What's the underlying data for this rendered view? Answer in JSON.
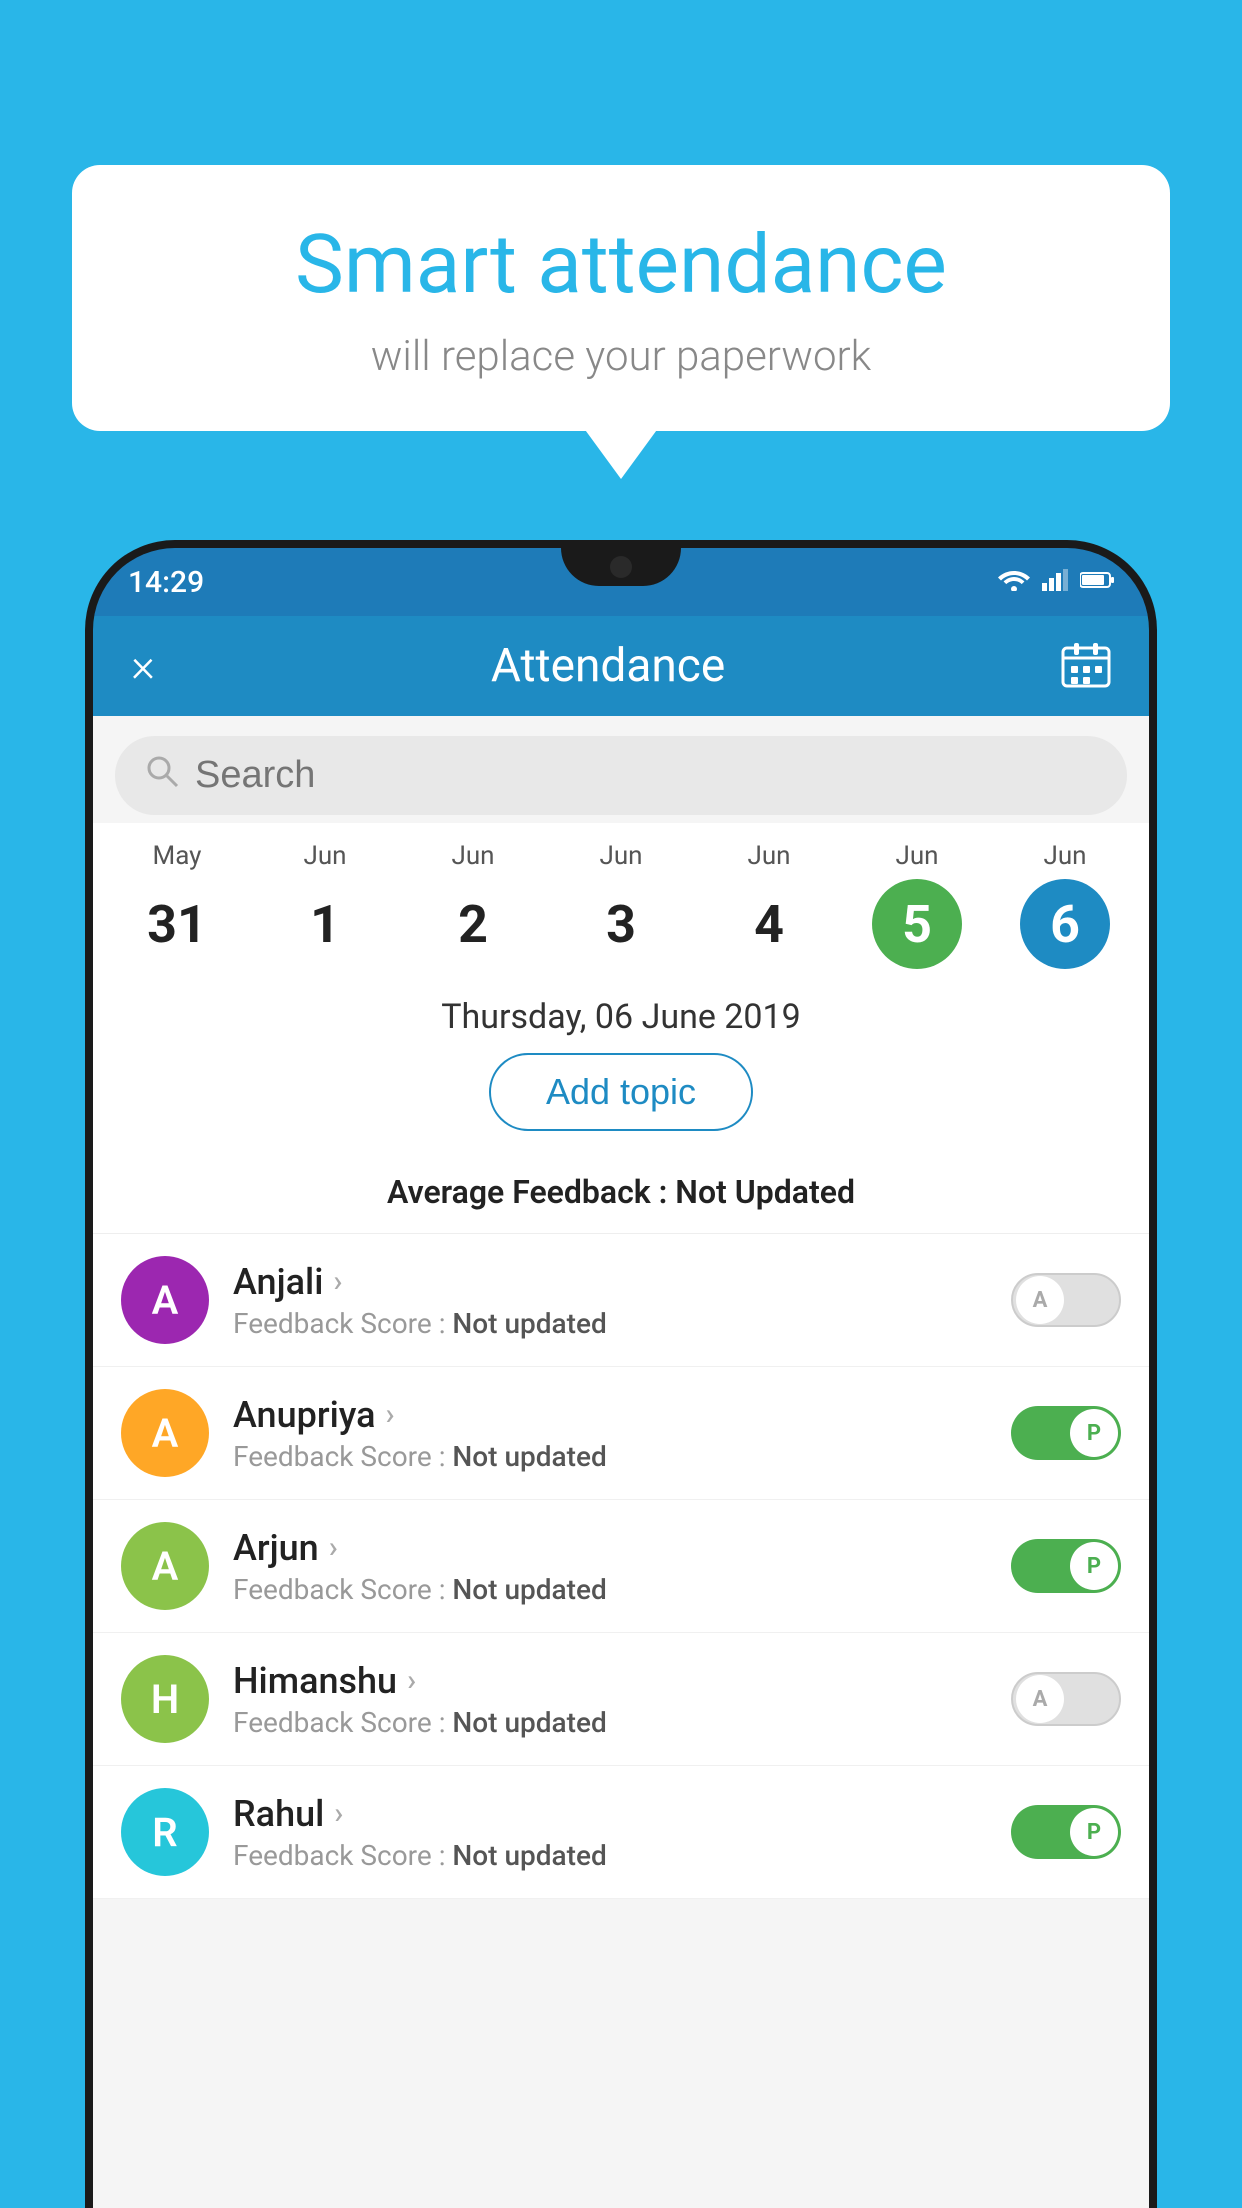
{
  "background_color": "#29b6e8",
  "bubble": {
    "title": "Smart attendance",
    "subtitle": "will replace your paperwork"
  },
  "status_bar": {
    "time": "14:29",
    "wifi_icon": "▲",
    "signal_icon": "▲",
    "battery_icon": "▮"
  },
  "header": {
    "title": "Attendance",
    "close_label": "×",
    "calendar_icon": "📅"
  },
  "search": {
    "placeholder": "Search"
  },
  "dates": [
    {
      "month": "May",
      "day": "31",
      "style": "normal"
    },
    {
      "month": "Jun",
      "day": "1",
      "style": "normal"
    },
    {
      "month": "Jun",
      "day": "2",
      "style": "normal"
    },
    {
      "month": "Jun",
      "day": "3",
      "style": "normal"
    },
    {
      "month": "Jun",
      "day": "4",
      "style": "normal"
    },
    {
      "month": "Jun",
      "day": "5",
      "style": "green"
    },
    {
      "month": "Jun",
      "day": "6",
      "style": "blue"
    }
  ],
  "selected_date": "Thursday, 06 June 2019",
  "add_topic_label": "Add topic",
  "avg_feedback_label": "Average Feedback :",
  "avg_feedback_value": "Not Updated",
  "students": [
    {
      "name": "Anjali",
      "avatar_letter": "A",
      "avatar_color": "#9c27b0",
      "feedback_label": "Feedback Score :",
      "feedback_value": "Not updated",
      "toggle_state": "off",
      "toggle_letter": "A"
    },
    {
      "name": "Anupriya",
      "avatar_letter": "A",
      "avatar_color": "#ffa726",
      "feedback_label": "Feedback Score :",
      "feedback_value": "Not updated",
      "toggle_state": "on",
      "toggle_letter": "P"
    },
    {
      "name": "Arjun",
      "avatar_letter": "A",
      "avatar_color": "#8bc34a",
      "feedback_label": "Feedback Score :",
      "feedback_value": "Not updated",
      "toggle_state": "on",
      "toggle_letter": "P"
    },
    {
      "name": "Himanshu",
      "avatar_letter": "H",
      "avatar_color": "#8bc34a",
      "feedback_label": "Feedback Score :",
      "feedback_value": "Not updated",
      "toggle_state": "off",
      "toggle_letter": "A"
    },
    {
      "name": "Rahul",
      "avatar_letter": "R",
      "avatar_color": "#26c6da",
      "feedback_label": "Feedback Score :",
      "feedback_value": "Not updated",
      "toggle_state": "on",
      "toggle_letter": "P"
    }
  ]
}
